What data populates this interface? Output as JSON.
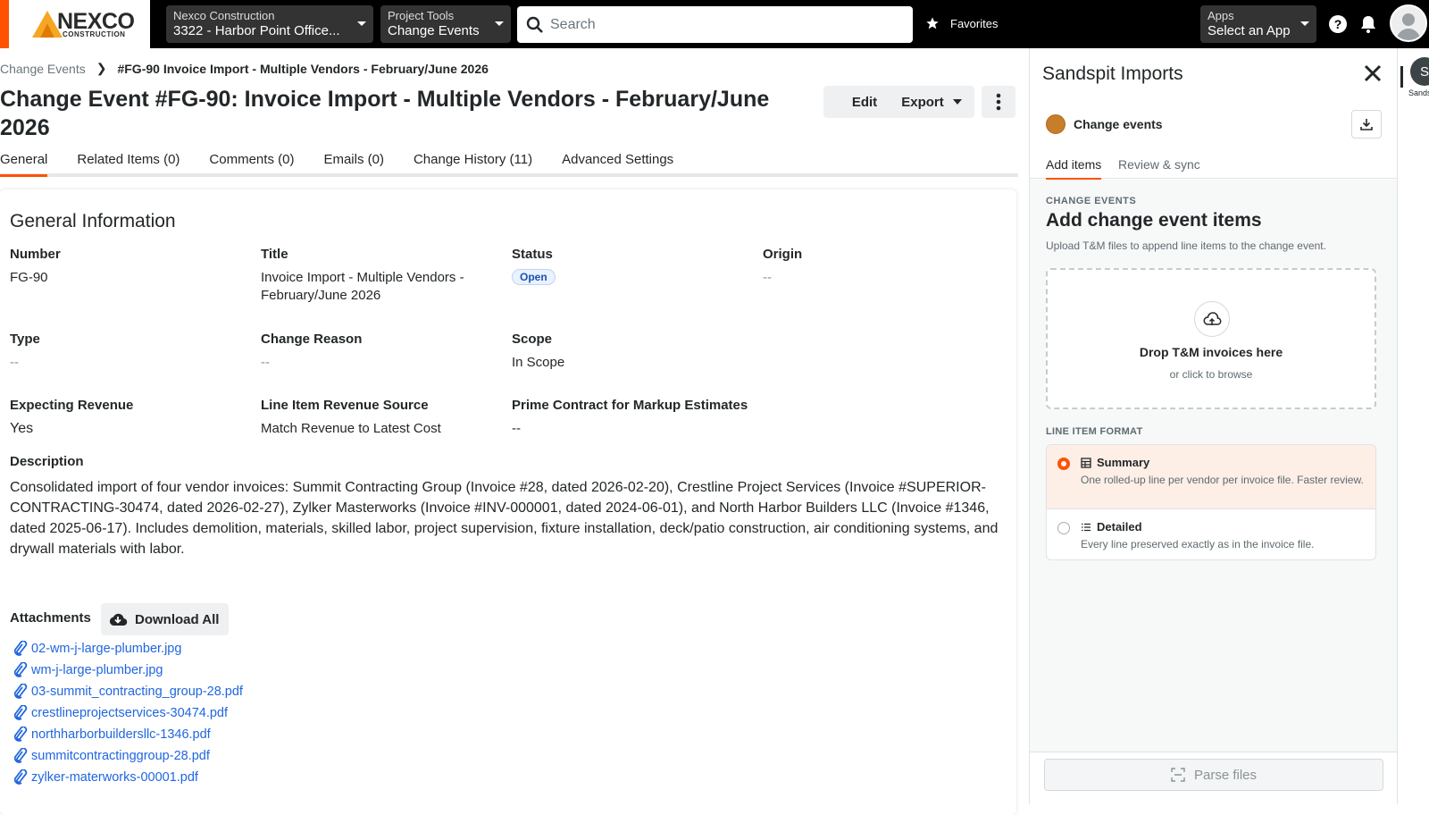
{
  "brand": {
    "name": "NEXCO",
    "sub": "CONSTRUCTION",
    "accent": "#ff5200"
  },
  "topbar": {
    "project": {
      "label": "Nexco Construction",
      "value": "3322 - Harbor Point Office..."
    },
    "tools": {
      "label": "Project Tools",
      "value": "Change Events"
    },
    "search_placeholder": "Search",
    "favorites": "Favorites",
    "apps": {
      "label": "Apps",
      "value": "Select an App"
    }
  },
  "breadcrumb": {
    "parent": "Change Events",
    "current": "#FG-90 Invoice Import - Multiple Vendors - February/June 2026"
  },
  "page": {
    "title": "Change Event #FG-90: Invoice Import - Multiple Vendors - February/June 2026",
    "edit": "Edit",
    "export": "Export"
  },
  "tabs": [
    "General",
    "Related Items (0)",
    "Comments (0)",
    "Emails (0)",
    "Change History (11)",
    "Advanced Settings"
  ],
  "general": {
    "heading": "General Information",
    "number": {
      "label": "Number",
      "value": "FG-90"
    },
    "title": {
      "label": "Title",
      "value": "Invoice Import - Multiple Vendors - February/June 2026"
    },
    "status": {
      "label": "Status",
      "value": "Open"
    },
    "origin": {
      "label": "Origin",
      "value": "--"
    },
    "type": {
      "label": "Type",
      "value": "--"
    },
    "change_reason": {
      "label": "Change Reason",
      "value": "--"
    },
    "scope": {
      "label": "Scope",
      "value": "In Scope"
    },
    "expecting_revenue": {
      "label": "Expecting Revenue",
      "value": "Yes"
    },
    "revenue_source": {
      "label": "Line Item Revenue Source",
      "value": "Match Revenue to Latest Cost"
    },
    "prime_contract": {
      "label": "Prime Contract for Markup Estimates",
      "value": "--"
    },
    "description": {
      "label": "Description",
      "value": "Consolidated import of four vendor invoices: Summit Contracting Group (Invoice #28, dated 2026-02-20), Crestline Project Services (Invoice #SUPERIOR-CONTRACTING-30474, dated 2026-02-27), Zylker Masterworks (Invoice #INV-000001, dated 2024-06-01), and North Harbor Builders LLC (Invoice #1346, dated 2025-06-17). Includes demolition, materials, skilled labor, project supervision, fixture installation, deck/patio construction, air conditioning systems, and drywall materials with labor."
    },
    "attachments_label": "Attachments",
    "download_all": "Download All",
    "files": [
      "02-wm-j-large-plumber.jpg",
      "wm-j-large-plumber.jpg",
      "03-summit_contracting_group-28.pdf",
      "crestlineprojectservices-30474.pdf",
      "northharborbuildersllc-1346.pdf",
      "summitcontractinggroup-28.pdf",
      "zylker-materworks-00001.pdf"
    ]
  },
  "panel": {
    "title": "Sandspit Imports",
    "entity": "Change events",
    "tabs": [
      "Add items",
      "Review & sync"
    ],
    "kicker": "CHANGE EVENTS",
    "heading": "Add change event items",
    "subtitle": "Upload T&M files to append line items to the change event.",
    "drop_title": "Drop T&M invoices here",
    "drop_sub": "or click to browse",
    "format_label": "LINE ITEM FORMAT",
    "options": [
      {
        "name": "Summary",
        "desc": "One rolled-up line per vendor per invoice file. Faster review.",
        "selected": true
      },
      {
        "name": "Detailed",
        "desc": "Every line preserved exactly as in the invoice file.",
        "selected": false
      }
    ],
    "parse": "Parse files"
  },
  "rail": {
    "avatar": "S",
    "label": "Sandsp"
  }
}
